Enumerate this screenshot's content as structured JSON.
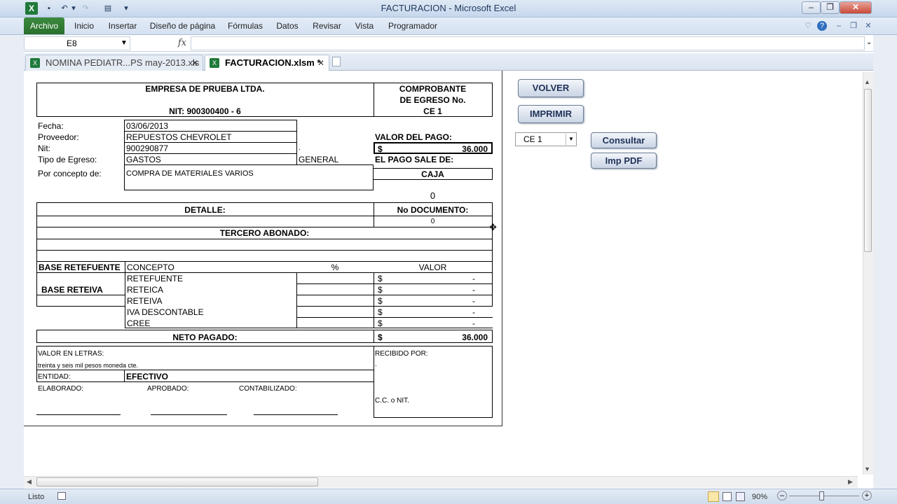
{
  "window": {
    "title": "FACTURACION  -  Microsoft Excel",
    "minimize": "–",
    "restore": "❐",
    "close": "✕"
  },
  "ribbon": {
    "tabs": [
      "Archivo",
      "Inicio",
      "Insertar",
      "Diseño de página",
      "Fórmulas",
      "Datos",
      "Revisar",
      "Vista",
      "Programador"
    ]
  },
  "formula_bar": {
    "name_box": "E8",
    "fx": "fx",
    "content": ""
  },
  "workbooks": [
    {
      "label": "NOMINA PEDIATR...PS may-2013.xls",
      "active": false
    },
    {
      "label": "FACTURACION.xlsm *",
      "active": true
    }
  ],
  "form": {
    "company": "EMPRESA DE PRUEBA LTDA.",
    "nit_company": "NIT: 900300400 - 6",
    "voucher_title_1": "COMPROBANTE",
    "voucher_title_2": "DE EGRESO No.",
    "voucher_number": "CE 1",
    "labels": {
      "fecha": "Fecha:",
      "proveedor": "Proveedor:",
      "nit": "Nit:",
      "tipo": "Tipo de Egreso:",
      "concepto": "Por concepto de:",
      "valor_pago": "VALOR DEL PAGO:",
      "pago_sale": "EL PAGO SALE DE:",
      "detalle": "DETALLE:",
      "no_documento": "No DOCUMENTO:",
      "tercero": "TERCERO ABONADO:",
      "base_retefuente": "BASE RETEFUENTE",
      "base_reteiva": "BASE RETEIVA",
      "concepto_col": "CONCEPTO",
      "pct_col": "%",
      "valor_col": "VALOR",
      "neto": "NETO PAGADO:",
      "valor_letras": "VALOR EN LETRAS:",
      "recibido": "RECIBIDO POR:",
      "entidad": "ENTIDAD:",
      "elaborado": "ELABORADO:",
      "aprobado": "APROBADO:",
      "contabilizado": "CONTABILIZADO:",
      "cc_nit": "C.C. o NIT."
    },
    "values": {
      "fecha": "03/06/2013",
      "proveedor": "REPUESTOS CHEVROLET",
      "nit": "900290877",
      "tipo": "GASTOS",
      "tipo_extra": "GENERAL",
      "concepto": "COMPRA DE MATERIALES VARIOS",
      "currency": "$",
      "valor_pago": "36.000",
      "pago_sale": "CAJA",
      "zero_a": "0",
      "no_documento": "0",
      "neto": "36.000",
      "letras": "treinta y seis mil pesos moneda cte.",
      "entidad": "EFECTIVO",
      "dot": "."
    },
    "retenciones": [
      {
        "concepto": "RETEFUENTE",
        "currency": "$",
        "valor": "-"
      },
      {
        "concepto": "RETEICA",
        "currency": "$",
        "valor": "-"
      },
      {
        "concepto": "RETEIVA",
        "currency": "$",
        "valor": "-"
      },
      {
        "concepto": "IVA DESCONTABLE",
        "currency": "$",
        "valor": "-"
      },
      {
        "concepto": "CREE",
        "currency": "$",
        "valor": "-"
      }
    ]
  },
  "buttons": {
    "volver": "VOLVER",
    "imprimir": "IMPRIMIR",
    "consultar": "Consultar",
    "imp_pdf": "Imp PDF"
  },
  "combo": {
    "selected": "CE 1"
  },
  "status": {
    "ready": "Listo",
    "zoom": "90%"
  }
}
